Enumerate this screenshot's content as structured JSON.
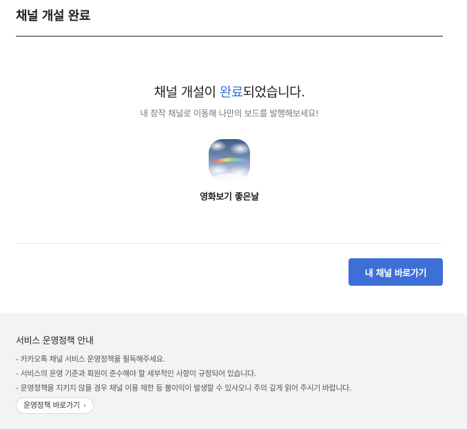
{
  "header": {
    "title": "채널 개설 완료"
  },
  "completion": {
    "headline_before": "채널 개설이 ",
    "headline_accent": "완료",
    "headline_after": "되었습니다.",
    "subtext": "내 창작 채널로 이동해 나만의 보드를 발행해보세요!",
    "channel_name": "영화보기 좋은날",
    "accent_color": "#3d6fd6"
  },
  "actions": {
    "go_channel_label": "내 채널 바로가기"
  },
  "policy": {
    "title": "서비스 운영정책 안내",
    "items": [
      "- 카카오톡 채널 서비스 운영정책을 필독해주세요.",
      "- 서비스의 운영 기준과 회원이 준수해야 할 세부적인 사항이 규정되어 있습니다.",
      "- 운영정책을 지키지 않을 경우 채널 이용 제한 등 불이익이 발생할 수 있사오니 주의 깊게 읽어 주시기 바랍니다."
    ],
    "link_label": "운영정책 바로가기",
    "link_icon": "chevron-right-icon"
  }
}
